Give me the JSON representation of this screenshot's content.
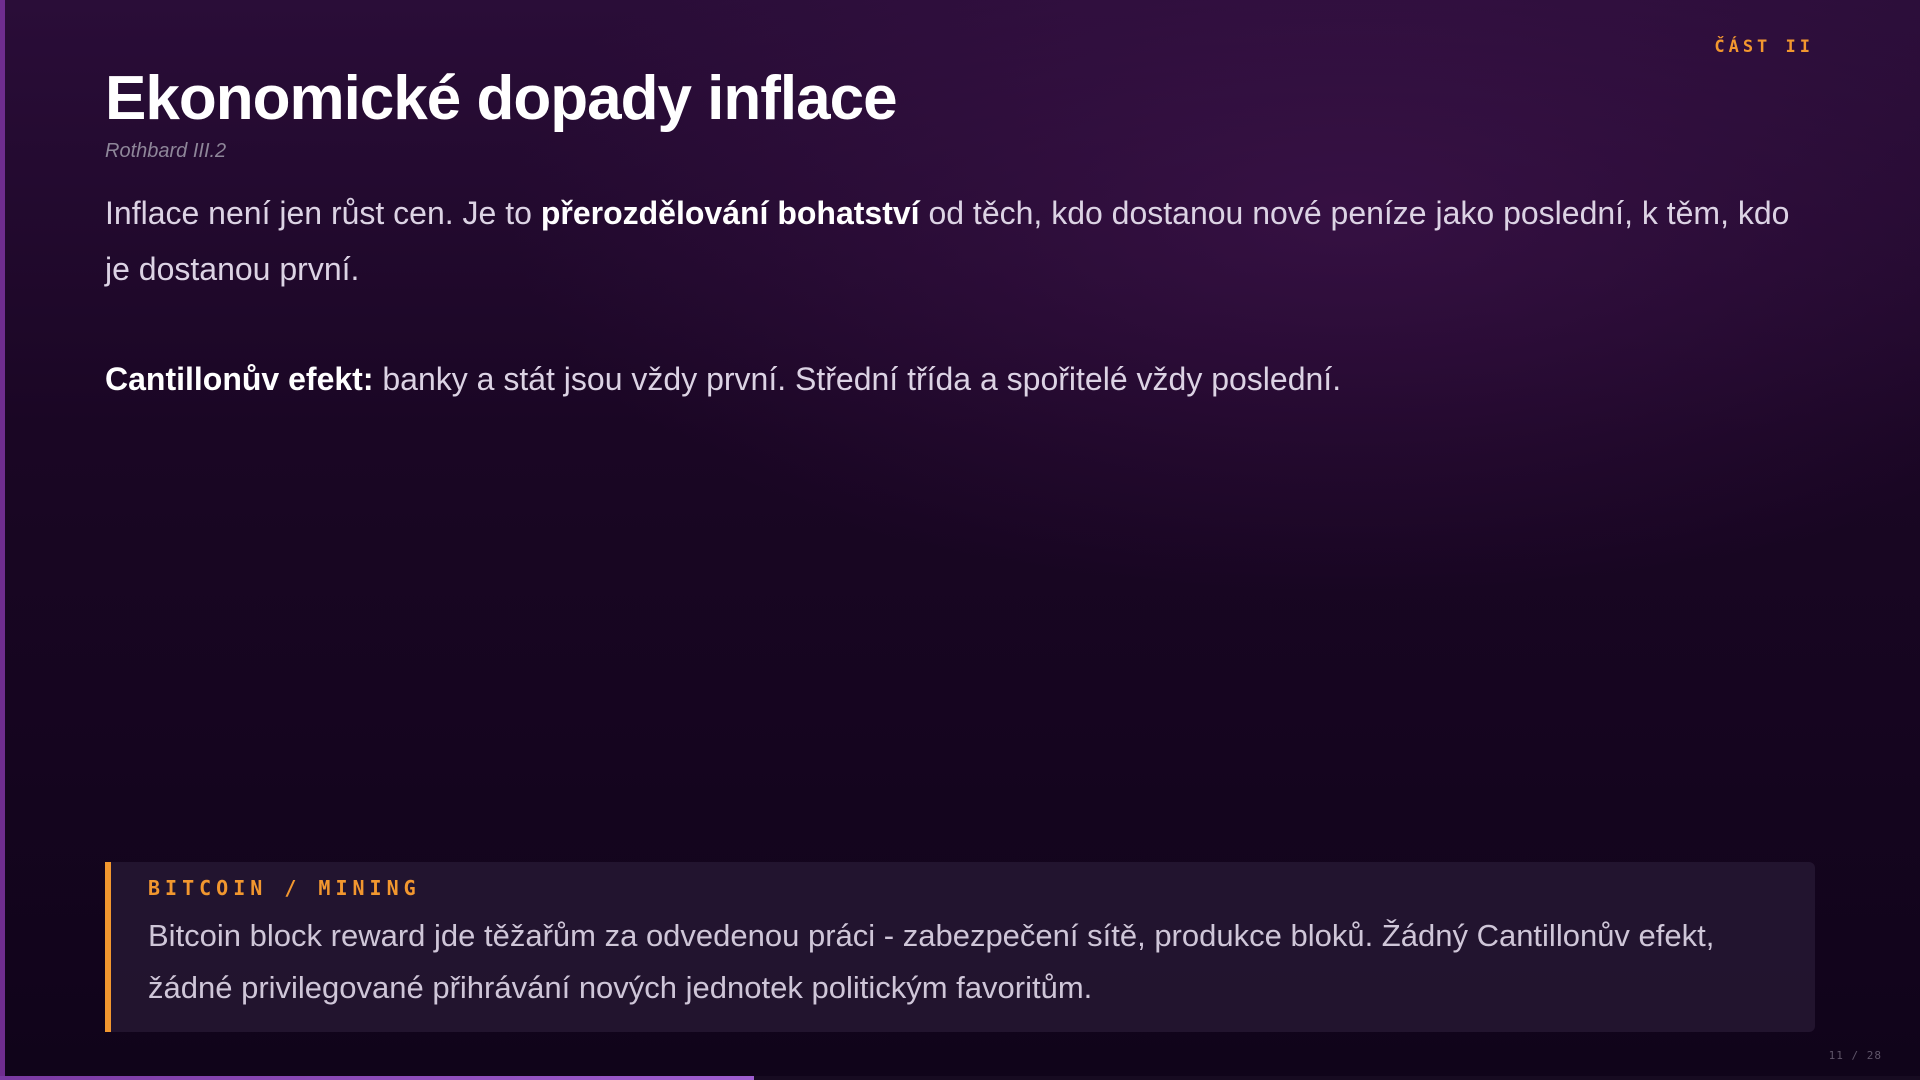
{
  "section_label": "ČÁST II",
  "slide": {
    "title": "Ekonomické dopady inflace",
    "subtitle": "Rothbard III.2",
    "paragraph1": {
      "lead": "Inflace není jen růst cen. Je to ",
      "emphasis": "přerozdělování bohatství",
      "rest": " od těch, kdo dostanou nové peníze jako poslední, k těm, kdo je dostanou první."
    },
    "paragraph2": {
      "emphasis": "Cantillonův efekt:",
      "rest": " banky a stát jsou vždy první. Střední třída a spořitelé vždy poslední."
    }
  },
  "callout": {
    "label": "BITCOIN / MINING",
    "text": "Bitcoin block reward jde těžařům za odvedenou práci - zabezpečení sítě, produkce bloků. Žádný Cantillonův efekt, žádné privilegované přihrávání nových jednotek politickým favoritům."
  },
  "pagination": {
    "label": "11 / 28",
    "current": 11,
    "total": 28
  },
  "colors": {
    "accent": "#f2972f",
    "title": "#ffffff",
    "progress": "#9f5ed0"
  }
}
